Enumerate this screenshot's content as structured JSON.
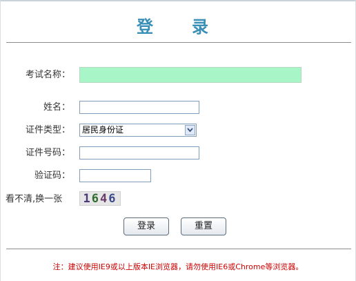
{
  "page": {
    "title": "登　录"
  },
  "form": {
    "exam_name": {
      "label": "考试名称：",
      "value": ""
    },
    "name": {
      "label": "姓名：",
      "value": ""
    },
    "id_type": {
      "label": "证件类型：",
      "selected": "居民身份证"
    },
    "id_number": {
      "label": "证件号码：",
      "value": ""
    },
    "captcha": {
      "label": "验证码：",
      "value": ""
    },
    "refresh": {
      "label": "看不清,换一张",
      "image_text": [
        "1",
        "6",
        "4",
        "6"
      ]
    }
  },
  "buttons": {
    "login": "登录",
    "reset": "重置"
  },
  "notice": "注：建议使用IE9或以上版本IE浏览器，请勿使用IE6或Chrome等浏览器。",
  "colors": {
    "title": "#3a8fb7",
    "exam_name_bg": "#a8f5c8",
    "notice": "#cc0000"
  }
}
